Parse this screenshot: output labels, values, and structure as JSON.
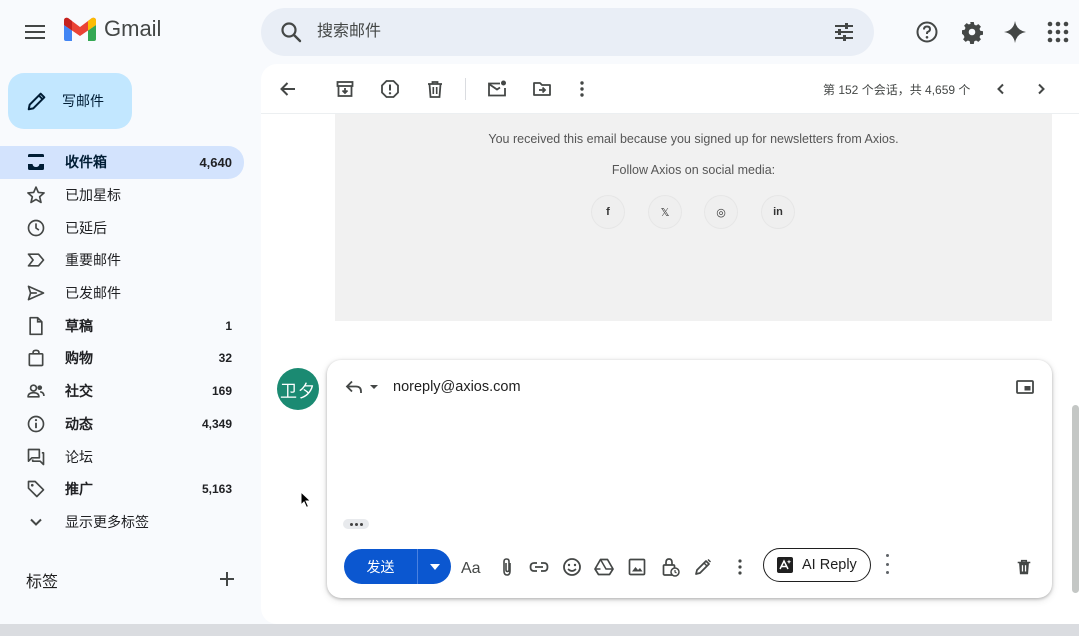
{
  "app": {
    "logo_text": "Gmail"
  },
  "search": {
    "placeholder": "搜索邮件"
  },
  "compose": {
    "label": "写邮件"
  },
  "nav": [
    {
      "label": "收件箱",
      "count": "4,640",
      "icon": "inbox-icon",
      "active": true
    },
    {
      "label": "已加星标",
      "count": "",
      "icon": "star-icon"
    },
    {
      "label": "已延后",
      "count": "",
      "icon": "clock-icon"
    },
    {
      "label": "重要邮件",
      "count": "",
      "icon": "important-icon"
    },
    {
      "label": "已发邮件",
      "count": "",
      "icon": "send-icon"
    },
    {
      "label": "草稿",
      "count": "1",
      "icon": "draft-icon"
    },
    {
      "label": "购物",
      "count": "32",
      "icon": "shopping-icon"
    },
    {
      "label": "社交",
      "count": "169",
      "icon": "people-icon"
    },
    {
      "label": "动态",
      "count": "4,349",
      "icon": "info-icon"
    },
    {
      "label": "论坛",
      "count": "",
      "icon": "forum-icon"
    },
    {
      "label": "推广",
      "count": "5,163",
      "icon": "tag-icon"
    },
    {
      "label": "显示更多标签",
      "count": "",
      "icon": "chevron-down-icon"
    }
  ],
  "labels": {
    "heading": "标签"
  },
  "toolbar": {
    "pager_text": "第 152 个会话，共 4,659 个"
  },
  "email_footer": {
    "line1": "You received this email because you signed up for newsletters from Axios.",
    "line2": "Follow Axios on social media:",
    "social": [
      "f",
      "𝕏",
      "◎",
      "in"
    ]
  },
  "reply": {
    "avatar_text": "卫夕",
    "to": "noreply@axios.com",
    "send_label": "发送",
    "ai_reply_label": "AI Reply"
  },
  "colors": {
    "accent": "#0b57d0",
    "compose_bg": "#c2e7ff",
    "active_nav": "#d3e3fd",
    "avatar": "#1b8a72"
  }
}
